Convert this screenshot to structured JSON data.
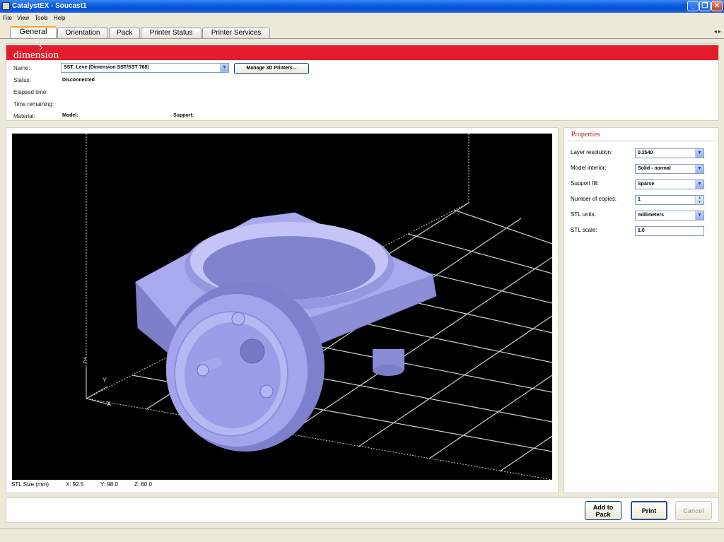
{
  "window": {
    "title": "CatalystEX - Soucast1"
  },
  "menu": [
    "File",
    "View",
    "Tools",
    "Help"
  ],
  "tabs": [
    {
      "label": "General",
      "active": true
    },
    {
      "label": "Orientation",
      "active": false
    },
    {
      "label": "Pack",
      "active": false
    },
    {
      "label": "Printer Status",
      "active": false
    },
    {
      "label": "Printer Services",
      "active": false
    }
  ],
  "header": {
    "logo": "dimension",
    "name_label": "Name:",
    "printer_name": "SST_Leve  (Dimension SST/SST 768)",
    "manage_button": "Manage 3D Printers...",
    "status_label": "Status:",
    "status_value": "Disconnected",
    "elapsed_label": "Elapsed time:",
    "remaining_label": "Time remaining:",
    "material_label": "Material:",
    "model_label": "Model:",
    "support_label": "Support:"
  },
  "viewport": {
    "axis_z": "Z",
    "axis_y": "Y",
    "axis_x": "X",
    "stl_size_label": "STL Size (mm)",
    "x": "X:  92.5",
    "y": "Y:  98.0",
    "z": "Z:  60.0",
    "model_color": "#9d9ee6"
  },
  "properties": {
    "title": "Properties",
    "layer_resolution_label": "Layer resolution:",
    "layer_resolution": "0.2540",
    "model_interior_label": "Model interior:",
    "model_interior": "Solid - normal",
    "support_fill_label": "Support fill:",
    "support_fill": "Sparse",
    "copies_label": "Number of copies:",
    "copies": "1",
    "stl_units_label": "STL units:",
    "stl_units": "millimeters",
    "stl_scale_label": "STL scale:",
    "stl_scale": "1.0"
  },
  "buttons": {
    "add_to_pack_line1": "Add to",
    "add_to_pack_line2": "Pack",
    "print": "Print",
    "cancel": "Cancel"
  },
  "colors": {
    "banner": "#e31b2b",
    "titlebar": "#0a5ce0",
    "properties_title": "#b22020"
  }
}
